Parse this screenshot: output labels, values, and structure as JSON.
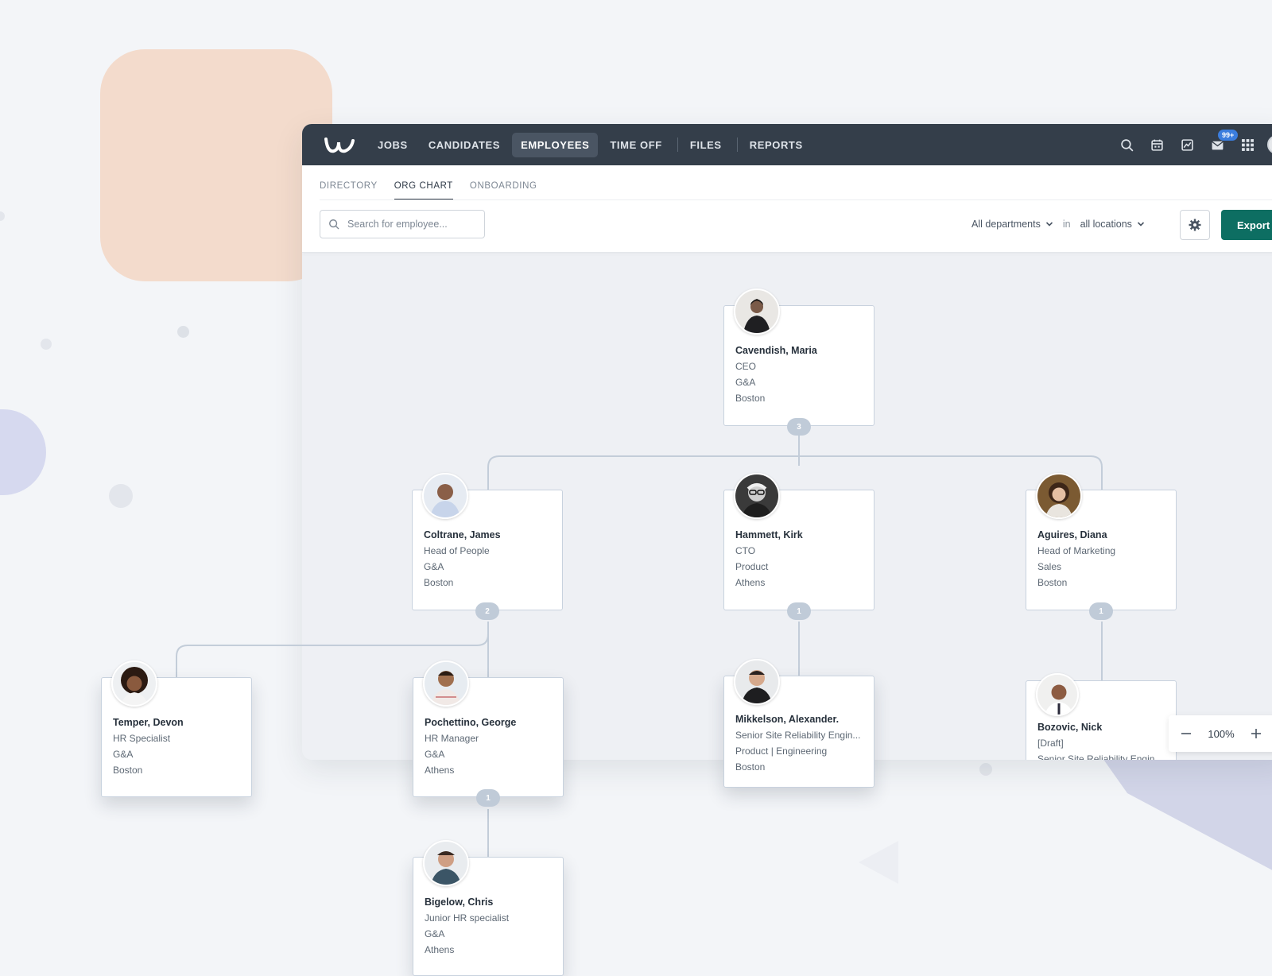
{
  "nav": {
    "items": [
      {
        "label": "JOBS",
        "active": false
      },
      {
        "label": "CANDIDATES",
        "active": false
      },
      {
        "label": "EMPLOYEES",
        "active": true
      },
      {
        "label": "TIME OFF",
        "active": false
      },
      {
        "label": "FILES",
        "active": false
      },
      {
        "label": "REPORTS",
        "active": false
      }
    ],
    "inbox_badge": "99+",
    "icons": [
      "search-icon",
      "calendar-icon",
      "analytics-icon",
      "inbox-icon",
      "apps-grid-icon"
    ]
  },
  "subtabs": [
    {
      "label": "DIRECTORY",
      "active": false
    },
    {
      "label": "ORG CHART",
      "active": true
    },
    {
      "label": "ONBOARDING",
      "active": false
    }
  ],
  "toolbar": {
    "search_placeholder": "Search for employee...",
    "department_filter": "All departments",
    "in_label": "in",
    "location_filter": "all locations",
    "export_label": "Export"
  },
  "zoom": {
    "value": "100%"
  },
  "org": {
    "cavendish": {
      "name": "Cavendish, Maria",
      "lines": [
        "CEO",
        "G&A",
        "Boston"
      ],
      "count": "3"
    },
    "coltrane": {
      "name": "Coltrane, James",
      "lines": [
        "Head of People",
        "G&A",
        "Boston"
      ],
      "count": "2"
    },
    "hammett": {
      "name": "Hammett, Kirk",
      "lines": [
        "CTO",
        "Product",
        "Athens"
      ],
      "count": "1"
    },
    "aguires": {
      "name": "Aguires, Diana",
      "lines": [
        "Head of Marketing",
        "Sales",
        "Boston"
      ],
      "count": "1"
    },
    "temper": {
      "name": "Temper, Devon",
      "lines": [
        "HR Specialist",
        "G&A",
        "Boston"
      ]
    },
    "pochettino": {
      "name": "Pochettino, George",
      "lines": [
        "HR Manager",
        "G&A",
        "Athens"
      ],
      "count": "1"
    },
    "mikkelson": {
      "name": "Mikkelson, Alexander.",
      "lines": [
        "Senior Site Reliability Engin...",
        "Product | Engineering",
        "Boston"
      ]
    },
    "bozovic": {
      "name": "Bozovic, Nick",
      "lines": [
        "[Draft]",
        "Senior Site Reliability Engin..."
      ]
    },
    "bigelow": {
      "name": "Bigelow, Chris",
      "lines": [
        "Junior HR specialist",
        "G&A",
        "Athens"
      ]
    }
  },
  "colors": {
    "topbar": "#343e4a",
    "export": "#0d6e62",
    "badge": "#3b7ddd",
    "connector": "#c3cdd9"
  }
}
